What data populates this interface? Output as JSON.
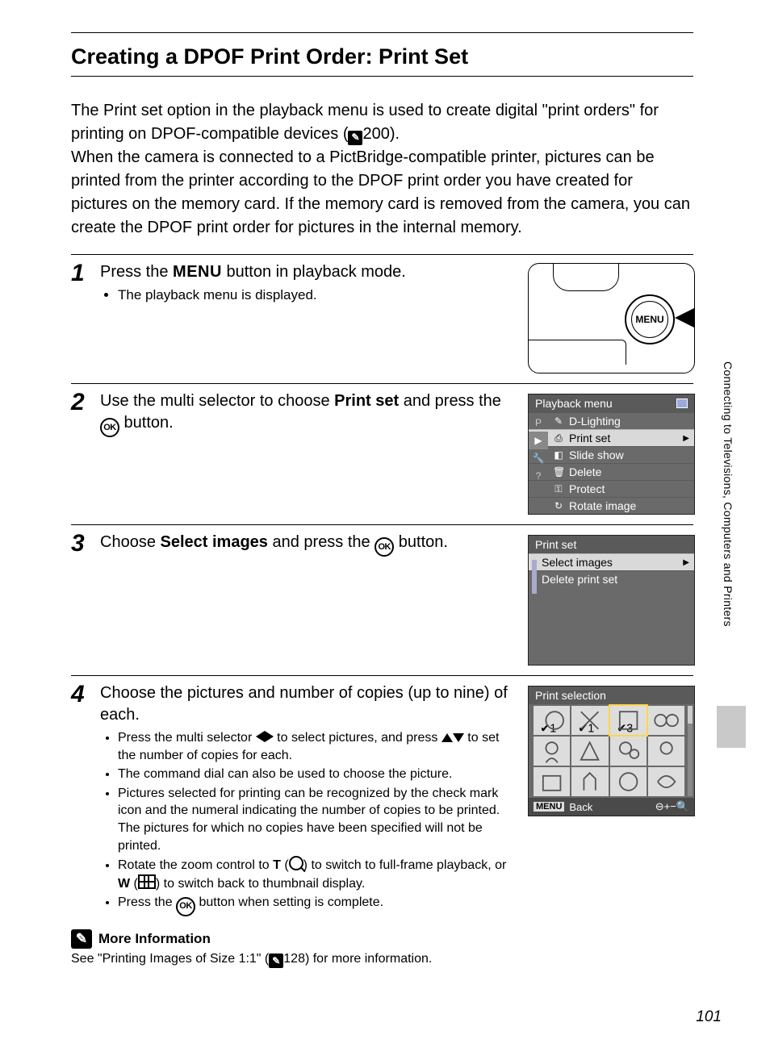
{
  "title": "Creating a DPOF Print Order: Print Set",
  "intro_a": "The Print set option in the playback menu is used to create digital \"print orders\" for printing on DPOF-compatible devices (",
  "intro_ref1": "200).",
  "intro_b": "When the camera is connected to a PictBridge-compatible printer, pictures can be printed from the printer according to the DPOF print order you have created for pictures on the memory card. If the memory card is removed from the camera, you can create the DPOF print order for pictures in the internal memory.",
  "steps": {
    "s1": {
      "num": "1",
      "head_a": "Press the ",
      "head_menu": "MENU",
      "head_b": " button in playback mode.",
      "bullet1": "The playback menu is displayed.",
      "menu_btn_label": "MENU"
    },
    "s2": {
      "num": "2",
      "head_a": "Use the multi selector to choose ",
      "head_bold": "Print set",
      "head_b": " and press the ",
      "head_c": " button.",
      "lcd_title": "Playback menu",
      "items": [
        "D-Lighting",
        "Print set",
        "Slide show",
        "Delete",
        "Protect",
        "Rotate image"
      ]
    },
    "s3": {
      "num": "3",
      "head_a": "Choose ",
      "head_bold": "Select images",
      "head_b": " and press the ",
      "head_c": " button.",
      "lcd_title": "Print set",
      "items": [
        "Select images",
        "Delete print set"
      ]
    },
    "s4": {
      "num": "4",
      "head": "Choose the pictures and number of copies (up to nine) of each.",
      "b1a": "Press the multi selector ",
      "b1b": " to select pictures, and press ",
      "b1c": " to set the number of copies for each.",
      "b2": "The command dial can also be used to choose the picture.",
      "b3": "Pictures selected for printing can be recognized by the check mark icon and the numeral indicating the number of copies to be printed. The pictures for which no copies have been specified will not be printed.",
      "b4a": "Rotate the zoom control to ",
      "b4_T": "T",
      "b4b": " (",
      "b4c": ") to switch to full-frame playback, or ",
      "b4_W": "W",
      "b4d": " (",
      "b4e": ") to switch back to thumbnail display.",
      "b5a": "Press the ",
      "b5b": " button when setting is complete.",
      "lcd_title": "Print selection",
      "ftr_back": "Back",
      "ftr_menu": "MENU"
    }
  },
  "more": {
    "title": "More Information",
    "body_a": "See \"Printing Images of Size 1:1\" (",
    "body_b": "128) for more information."
  },
  "side_label": "Connecting to Televisions, Computers and Printers",
  "page_num": "101"
}
